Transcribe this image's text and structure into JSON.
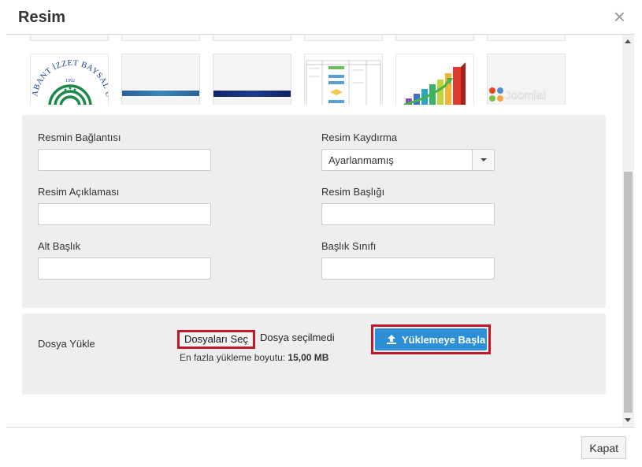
{
  "dialog": {
    "title": "Resim",
    "close_icon": "×",
    "close_button_label": "Kapat"
  },
  "gallery": {
    "images": [
      {
        "name": "university-logo-thumbnail",
        "logo_text": "ABANT İZZET BAYSAL ÜNİVERSİTESİ",
        "year": "1992"
      },
      {
        "name": "banner-thumbnail-1"
      },
      {
        "name": "banner-thumbnail-2"
      },
      {
        "name": "flowchart-thumbnail"
      },
      {
        "name": "bar-chart-thumbnail"
      },
      {
        "name": "joomla-logo-thumbnail",
        "logo_text": "Joomla!"
      }
    ]
  },
  "form": {
    "link_label": "Resmin Bağlantısı",
    "link_value": "",
    "float_label": "Resim Kaydırma",
    "float_value": "Ayarlanmamış",
    "description_label": "Resim Açıklaması",
    "description_value": "",
    "image_title_label": "Resim Başlığı",
    "image_title_value": "",
    "caption_label": "Alt Başlık",
    "caption_value": "",
    "caption_class_label": "Başlık Sınıfı",
    "caption_class_value": ""
  },
  "upload": {
    "label": "Dosya Yükle",
    "choose_files_label": "Dosyaları Seç",
    "no_file_text": "Dosya seçilmedi",
    "max_size_prefix": "En fazla yükleme boyutu:",
    "max_size_value": "15,00 MB",
    "start_upload_label": "Yüklemeye Başla"
  },
  "colors": {
    "primary_button": "#2d8fd5",
    "highlight_border": "#c3172a",
    "panel_background": "#eeeeee"
  }
}
